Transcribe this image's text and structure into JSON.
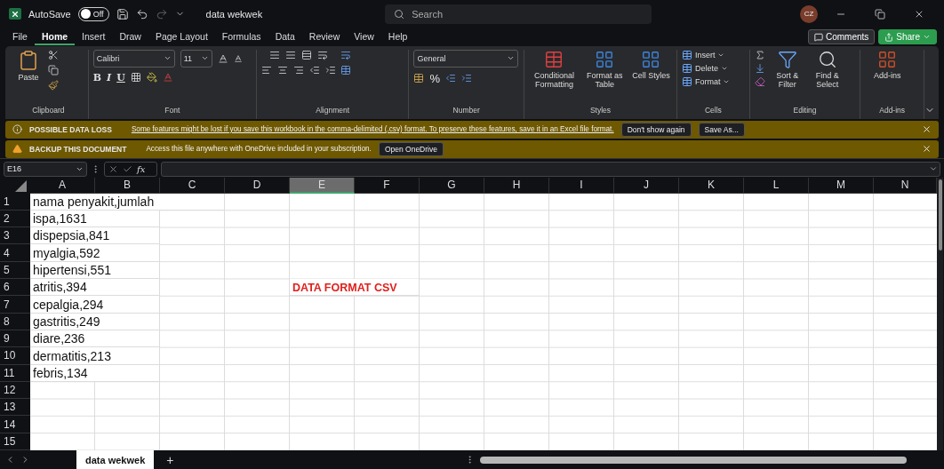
{
  "title_bar": {
    "autosave": "AutoSave",
    "autosave_toggle": {
      "label": "Off",
      "on": false
    },
    "file_name": "data wekwek",
    "search": {
      "placeholder": "Search"
    },
    "avatar": "CZ"
  },
  "menu_tabs": [
    {
      "label": "File",
      "selected": false
    },
    {
      "label": "Home",
      "selected": true
    },
    {
      "label": "Insert",
      "selected": false
    },
    {
      "label": "Draw",
      "selected": false
    },
    {
      "label": "Page Layout",
      "selected": false
    },
    {
      "label": "Formulas",
      "selected": false
    },
    {
      "label": "Data",
      "selected": false
    },
    {
      "label": "Review",
      "selected": false
    },
    {
      "label": "View",
      "selected": false
    },
    {
      "label": "Help",
      "selected": false
    }
  ],
  "comments": "Comments",
  "share": "Share",
  "ribbon": {
    "groups": [
      {
        "label": "Clipboard",
        "kind": "clipboard",
        "paste": "Paste"
      },
      {
        "label": "Font",
        "kind": "font",
        "font": "Calibri",
        "size": "11",
        "bold": "B",
        "italic": "I",
        "underline": "U"
      },
      {
        "label": "Alignment",
        "kind": "alignment"
      },
      {
        "label": "Number",
        "kind": "number",
        "format": "General",
        "percent": "%"
      },
      {
        "label": "Styles",
        "kind": "styles",
        "buttons": [
          "Conditional Formatting",
          "Format as Table",
          "Cell Styles"
        ]
      },
      {
        "label": "Cells",
        "kind": "cells",
        "buttons": [
          "Insert",
          "Delete",
          "Format"
        ]
      },
      {
        "label": "Editing",
        "kind": "editing",
        "buttons": [
          "Sort & Filter",
          "Find & Select"
        ]
      },
      {
        "label": "Add-ins",
        "kind": "addins",
        "buttons": [
          "Add-ins"
        ]
      }
    ]
  },
  "message_bars": [
    {
      "kind": "info",
      "title": "POSSIBLE DATA LOSS",
      "text": "Some features might be lost if you save this workbook in the comma-delimited (.csv) format. To preserve these features, save it in an Excel file format.",
      "link": true,
      "buttons": [
        "Don't show again",
        "Save As..."
      ]
    },
    {
      "kind": "warning",
      "title": "BACKUP THIS DOCUMENT",
      "text": "Access this file anywhere with OneDrive included in your subscription.",
      "link": false,
      "buttons": [
        "Open OneDrive"
      ]
    }
  ],
  "formula_bar": {
    "name_box": "E16",
    "function_label": "fx"
  },
  "grid": {
    "columns": [
      {
        "label": "A",
        "selected": false
      },
      {
        "label": "B",
        "selected": false
      },
      {
        "label": "C",
        "selected": false
      },
      {
        "label": "D",
        "selected": false
      },
      {
        "label": "E",
        "selected": true
      },
      {
        "label": "F",
        "selected": false
      },
      {
        "label": "G",
        "selected": false
      },
      {
        "label": "H",
        "selected": false
      },
      {
        "label": "I",
        "selected": false
      },
      {
        "label": "J",
        "selected": false
      },
      {
        "label": "K",
        "selected": false
      },
      {
        "label": "L",
        "selected": false
      },
      {
        "label": "M",
        "selected": false
      },
      {
        "label": "N",
        "selected": false
      }
    ],
    "rows": [
      {
        "number": "1",
        "cells": [
          {
            "text": "nama penyakit,jumlah",
            "emphasis": false
          }
        ]
      },
      {
        "number": "2",
        "cells": [
          {
            "text": "ispa,1631",
            "emphasis": false
          }
        ]
      },
      {
        "number": "3",
        "cells": [
          {
            "text": "dispepsia,841",
            "emphasis": false
          }
        ]
      },
      {
        "number": "4",
        "cells": [
          {
            "text": "myalgia,592",
            "emphasis": false
          }
        ]
      },
      {
        "number": "5",
        "cells": [
          {
            "text": "hipertensi,551",
            "emphasis": false
          }
        ]
      },
      {
        "number": "6",
        "cells": [
          {
            "text": "atritis,394",
            "emphasis": false
          },
          {
            "text": ""
          },
          {
            "text": ""
          },
          {
            "text": ""
          },
          {
            "text": "DATA FORMAT CSV",
            "emphasis": true
          }
        ]
      },
      {
        "number": "7",
        "cells": [
          {
            "text": "cepalgia,294",
            "emphasis": false
          }
        ]
      },
      {
        "number": "8",
        "cells": [
          {
            "text": "gastritis,249",
            "emphasis": false
          }
        ]
      },
      {
        "number": "9",
        "cells": [
          {
            "text": "diare,236",
            "emphasis": false
          }
        ]
      },
      {
        "number": "10",
        "cells": [
          {
            "text": "dermatitis,213",
            "emphasis": false
          }
        ]
      },
      {
        "number": "11",
        "cells": [
          {
            "text": "febris,134",
            "emphasis": false
          }
        ]
      },
      {
        "number": "12",
        "cells": []
      },
      {
        "number": "13",
        "cells": []
      },
      {
        "number": "14",
        "cells": []
      },
      {
        "number": "15",
        "cells": []
      }
    ]
  },
  "sheet_tabs": [
    {
      "label": "data wekwek",
      "selected": true
    }
  ],
  "add_sheet": "+"
}
